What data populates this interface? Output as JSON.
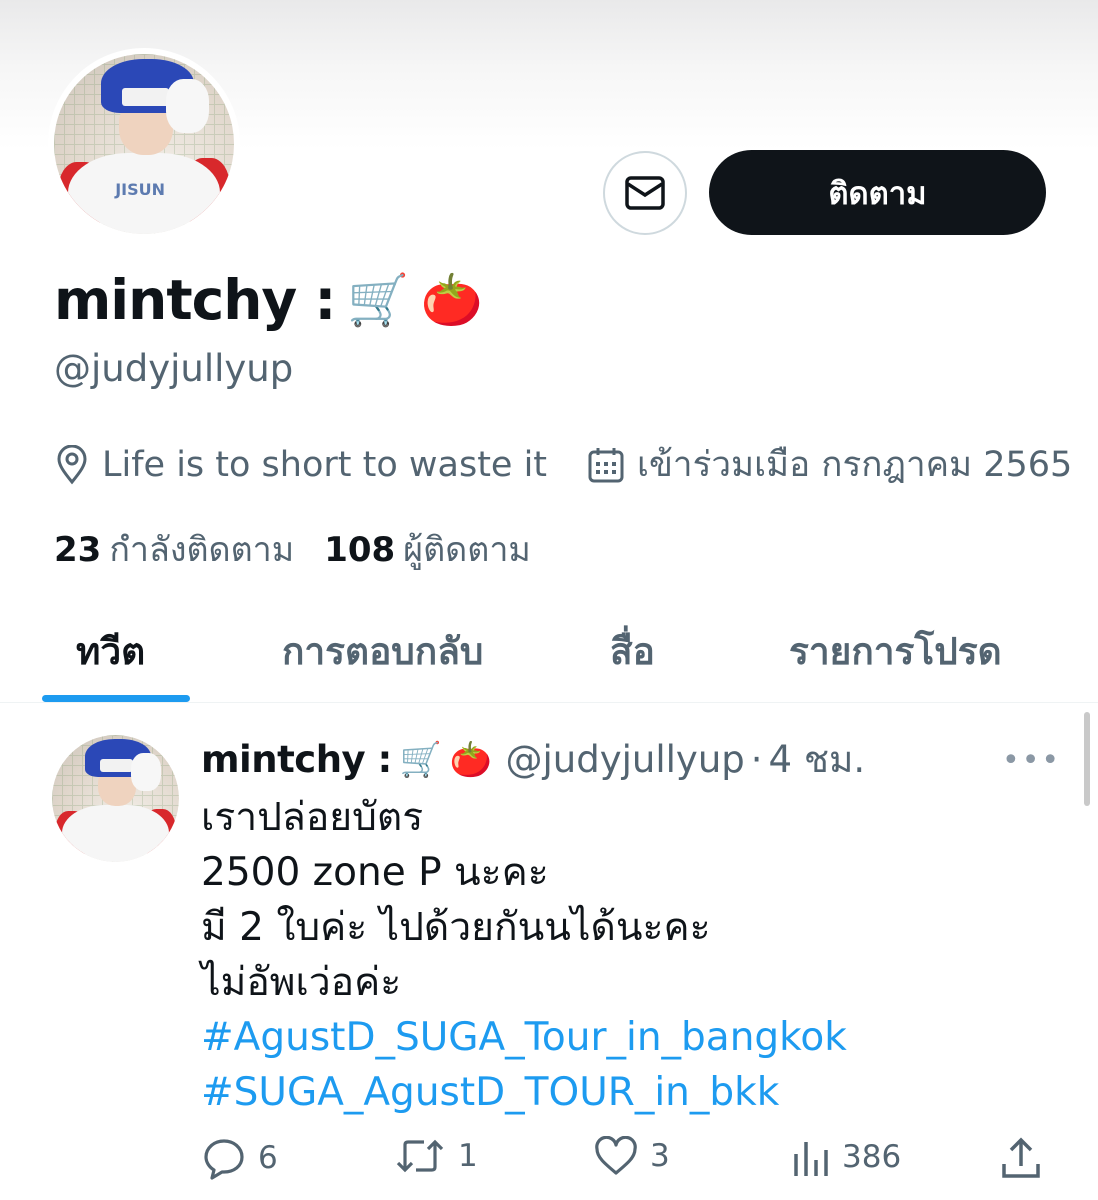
{
  "profile": {
    "display_name": "mintchy :",
    "name_emojis": [
      "🛒",
      "🍅"
    ],
    "handle": "@judyjullyup",
    "location": "Life is to short to waste it",
    "joined": "เข้าร่วมเมือ กรกฎาคม 2565",
    "following_count": "23",
    "following_label": "กำลังติดตาม",
    "followers_count": "108",
    "followers_label": "ผู้ติดตาม",
    "follow_button": "ติดตาม"
  },
  "tabs": [
    {
      "label": "ทวีต",
      "active": true
    },
    {
      "label": "การตอบกลับ",
      "active": false
    },
    {
      "label": "สื่อ",
      "active": false
    },
    {
      "label": "รายการโปรด",
      "active": false
    }
  ],
  "tweet": {
    "name": "mintchy :",
    "emojis": [
      "🛒",
      "🍅"
    ],
    "handle": "@judyjullyup",
    "dot": "·",
    "time": "4 ชม.",
    "more": "•••",
    "lines": [
      "เราปล่อยบัตร",
      "2500 zone P นะคะ",
      "มี 2 ใบค่ะ ไปด้วยกันนได้นะคะ",
      "ไม่อัพเว่อค่ะ"
    ],
    "hashtags": [
      "#AgustD_SUGA_Tour_in_bangkok",
      "#SUGA_AgustD_TOUR_in_bkk"
    ],
    "replies": "6",
    "retweets": "1",
    "likes": "3",
    "views": "386"
  },
  "icons": {
    "message": "envelope-icon",
    "location": "location-pin-icon",
    "calendar": "calendar-icon",
    "reply": "reply-icon",
    "retweet": "retweet-icon",
    "like": "heart-icon",
    "views": "views-icon",
    "share": "share-icon"
  },
  "colors": {
    "accent": "#1d9bf0",
    "text": "#0f1419",
    "secondary": "#536471",
    "follow_bg": "#0f1419"
  }
}
